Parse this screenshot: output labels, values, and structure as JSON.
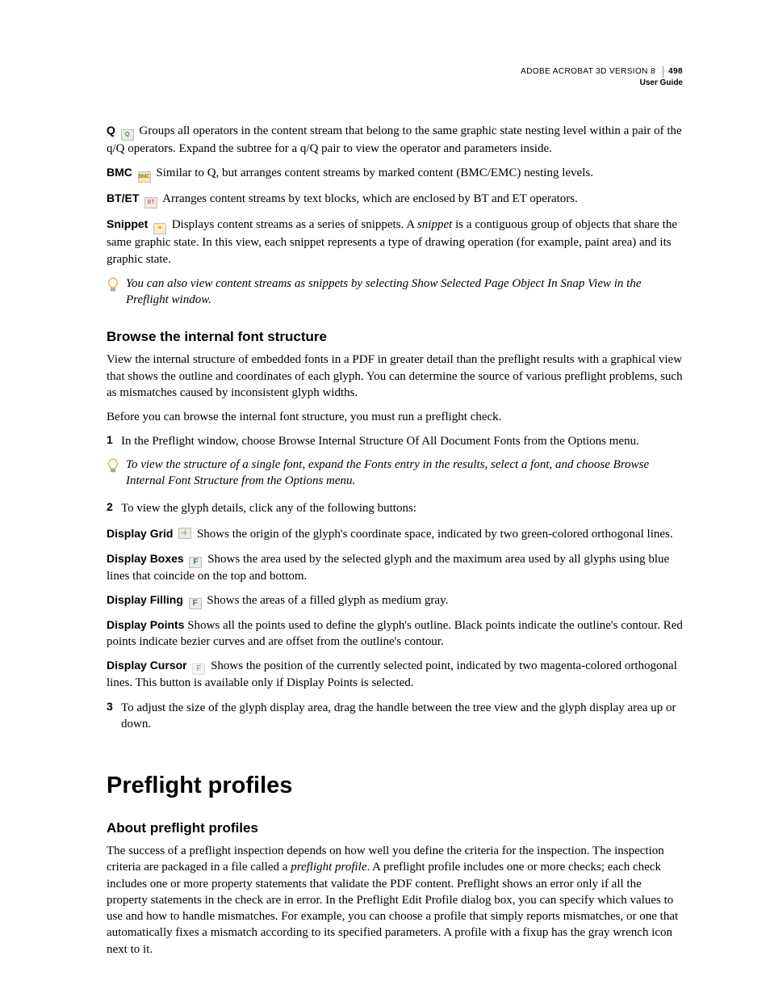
{
  "header": {
    "product": "ADOBE ACROBAT 3D VERSION 8",
    "guide": "User Guide",
    "page": "498"
  },
  "items": {
    "q": {
      "term": "Q",
      "text": "Groups all operators in the content stream that belong to the same graphic state nesting level within a pair of the q/Q operators. Expand the subtree for a q/Q pair to view the operator and parameters inside."
    },
    "bmc": {
      "term": "BMC",
      "text": "Similar to Q, but arranges content streams by marked content (BMC/EMC) nesting levels."
    },
    "btet": {
      "term": "BT/ET",
      "text": "Arranges content streams by text blocks, which are enclosed by BT and ET operators."
    },
    "snippet": {
      "term": "Snippet",
      "pre": "Displays content streams as a series of snippets. A ",
      "em": "snippet",
      "post": " is a contiguous group of objects that share the same graphic state. In this view, each snippet represents a type of drawing operation (for example, paint area) and its graphic state."
    }
  },
  "tip1": "You can also view content streams as snippets by selecting Show Selected Page Object In Snap View in the Preflight window.",
  "section1": {
    "title": "Browse the internal font structure",
    "p1": "View the internal structure of embedded fonts in a PDF in greater detail than the preflight results with a graphical view that shows the outline and coordinates of each glyph. You can determine the source of various preflight problems, such as mismatches caused by inconsistent glyph widths.",
    "p2": "Before you can browse the internal font structure, you must run a preflight check."
  },
  "steps": {
    "s1": {
      "num": "1",
      "text": "In the Preflight window, choose Browse Internal Structure Of All Document Fonts from the Options menu."
    },
    "tip2": "To view the structure of a single font, expand the Fonts entry in the results, select a font, and choose Browse Internal Font Structure from the Options menu.",
    "s2": {
      "num": "2",
      "text": "To view the glyph details, click any of the following buttons:"
    }
  },
  "display": {
    "grid": {
      "term": "Display Grid",
      "text": "Shows the origin of the glyph's coordinate space, indicated by two green-colored orthogonal lines."
    },
    "boxes": {
      "term": "Display Boxes",
      "text": "Shows the area used by the selected glyph and the maximum area used by all glyphs using blue lines that coincide on the top and bottom."
    },
    "filling": {
      "term": "Display Filling",
      "text": "Shows the areas of a filled glyph as medium gray."
    },
    "points": {
      "term": "Display Points",
      "text": "Shows all the points used to define the glyph's outline. Black points indicate the outline's contour. Red points indicate bezier curves and are offset from the outline's contour."
    },
    "cursor": {
      "term": "Display Cursor",
      "text": "Shows the position of the currently selected point, indicated by two magenta-colored orthogonal lines. This button is available only if Display Points is selected."
    }
  },
  "step3": {
    "num": "3",
    "text": "To adjust the size of the glyph display area, drag the handle between the tree view and the glyph display area up or down."
  },
  "section2": {
    "title": "Preflight profiles",
    "sub": "About preflight profiles",
    "p_pre": "The success of a preflight inspection depends on how well you define the criteria for the inspection. The inspection criteria are packaged in a file called a ",
    "p_em": "preflight profile",
    "p_post": ". A preflight profile includes one or more checks; each check includes one or more property statements that validate the PDF content. Preflight shows an error only if all the property statements in the check are in error. In the Preflight Edit Profile dialog box, you can specify which values to use and how to handle mismatches. For example, you can choose a profile that simply reports mismatches, or one that automatically fixes a mismatch according to its specified parameters. A profile with a fixup has the gray wrench icon next to it."
  }
}
